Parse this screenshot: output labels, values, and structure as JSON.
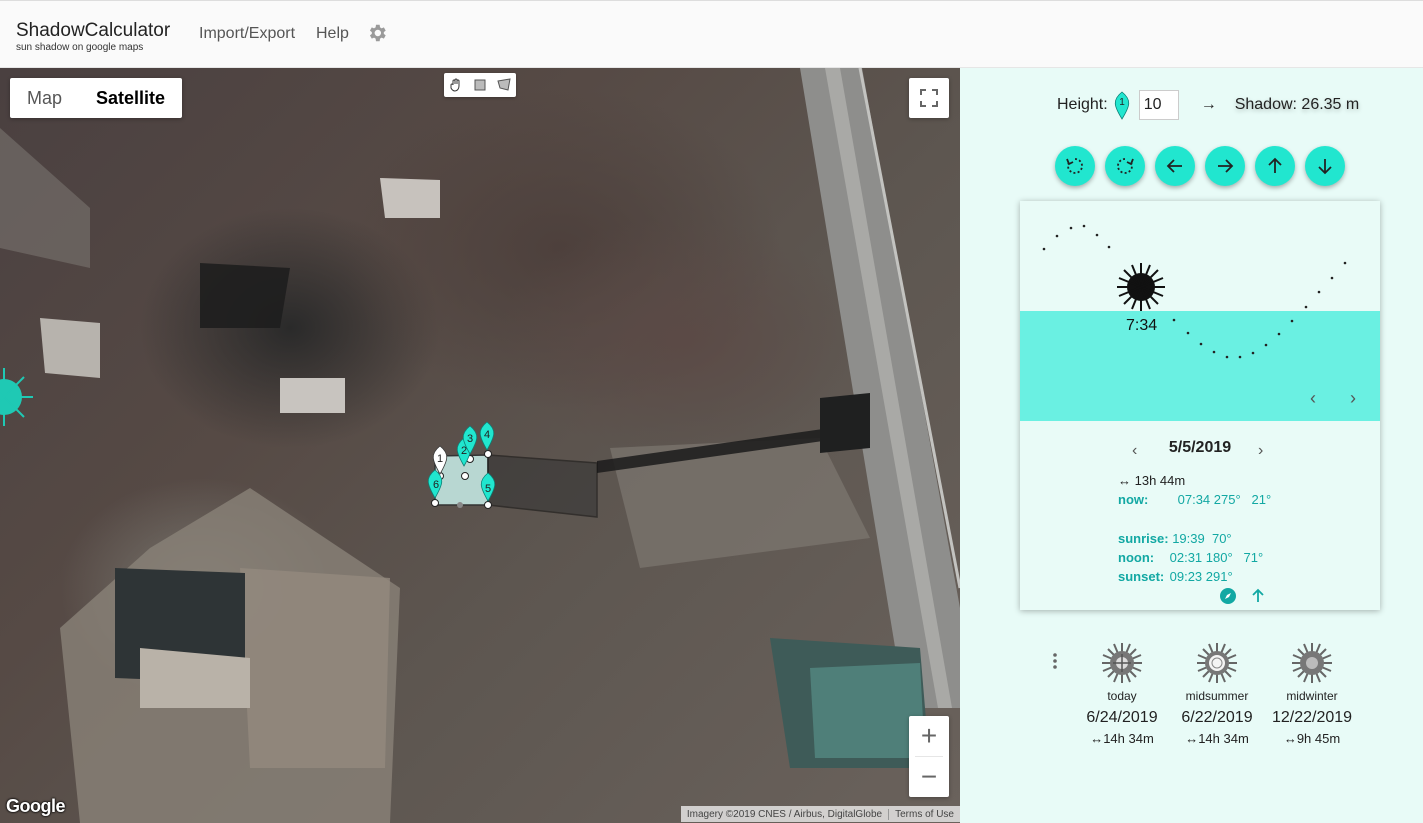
{
  "header": {
    "title": "ShadowCalculator",
    "subtitle": "sun shadow on google maps",
    "nav": [
      "Import/Export",
      "Help"
    ],
    "settings_icon": "gear-icon"
  },
  "map": {
    "type_controls": [
      "Map",
      "Satellite"
    ],
    "selected_type": "Satellite",
    "draw_tools": [
      "hand-icon",
      "rectangle-icon",
      "polygon-icon"
    ],
    "markers": [
      "1",
      "2",
      "3",
      "4",
      "5",
      "6"
    ],
    "zoom_in": "+",
    "zoom_out": "−",
    "logo": "Google",
    "attribution": "Imagery ©2019 CNES / Airbus, DigitalGlobe",
    "terms": "Terms of Use"
  },
  "panel": {
    "height_label": "Height:",
    "height_marker": "1",
    "height_value": "10",
    "arrow": "→",
    "shadow_label": "Shadow: 26.35 m",
    "buttons": [
      "rotate-left-icon",
      "rotate-right-icon",
      "arrow-left-icon",
      "arrow-right-icon",
      "arrow-up-icon",
      "arrow-down-icon"
    ],
    "sun_time": "7:34",
    "arc_prev": "‹",
    "arc_next": "›",
    "date": "5/5/2019",
    "date_prev": "‹",
    "date_next": "›",
    "day_length": "↔ 13h 44m",
    "now_label": "now:",
    "now_value": "07:34 275°   21°",
    "sunrise_label": "sunrise:",
    "sunrise_value": "19:39  70°",
    "noon_label": "noon:",
    "noon_value": "02:31 180°   71°",
    "sunset_label": "sunset:",
    "sunset_value": "09:23 291°",
    "card_icons": [
      "compass-icon",
      "north-arrow-icon"
    ]
  },
  "presets": [
    {
      "name": "today",
      "date": "6/24/2019",
      "duration": "↔14h 34m"
    },
    {
      "name": "midsummer",
      "date": "6/22/2019",
      "duration": "↔14h 34m"
    },
    {
      "name": "midwinter",
      "date": "12/22/2019",
      "duration": "↔9h 45m"
    }
  ],
  "colors": {
    "accent": "#21e6cf",
    "panel_bg": "#e8fbf7",
    "ground": "#6af0e2",
    "info_text": "#12a8a3"
  }
}
